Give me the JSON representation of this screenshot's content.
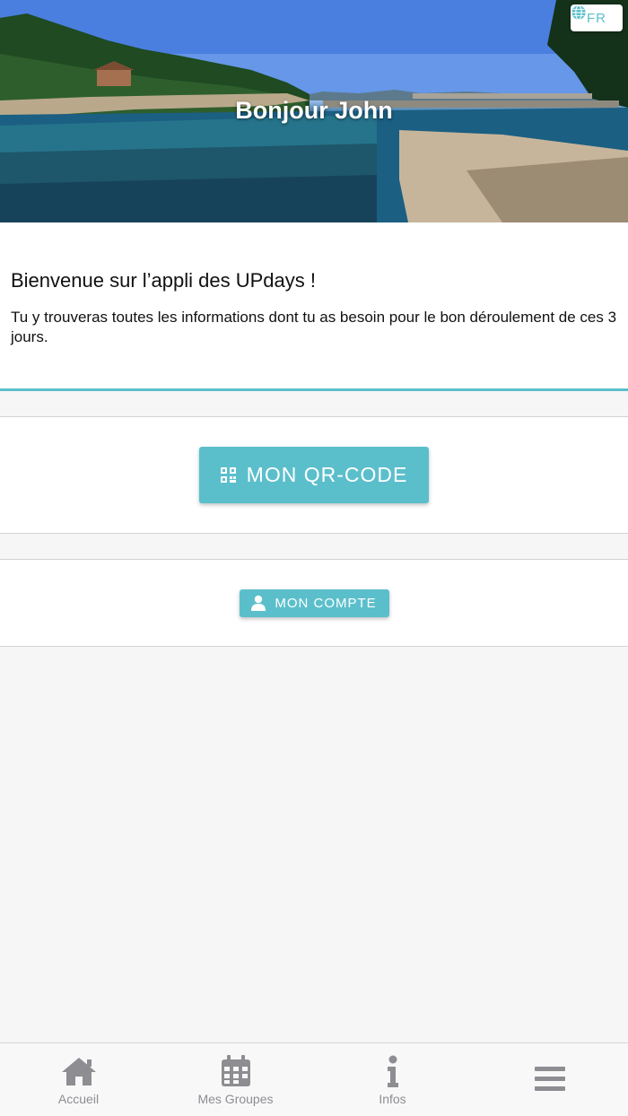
{
  "header": {
    "greeting": "Bonjour John",
    "language": "FR"
  },
  "welcome": {
    "title": "Bienvenue sur l’appli des UPdays !",
    "text": "Tu y trouveras toutes les informations dont tu as besoin pour le bon déroulement de ces 3 jours."
  },
  "actions": {
    "qr_label": "MON QR-CODE",
    "account_label": "MON COMPTE"
  },
  "nav": {
    "items": [
      {
        "label": "Accueil",
        "icon": "home-icon"
      },
      {
        "label": "Mes Groupes",
        "icon": "calendar-icon"
      },
      {
        "label": "Infos",
        "icon": "info-icon"
      },
      {
        "label": "",
        "icon": "menu-icon"
      }
    ]
  },
  "colors": {
    "accent": "#5bbfcb",
    "nav_icon": "#8d8d92",
    "background": "#f6f6f6"
  }
}
